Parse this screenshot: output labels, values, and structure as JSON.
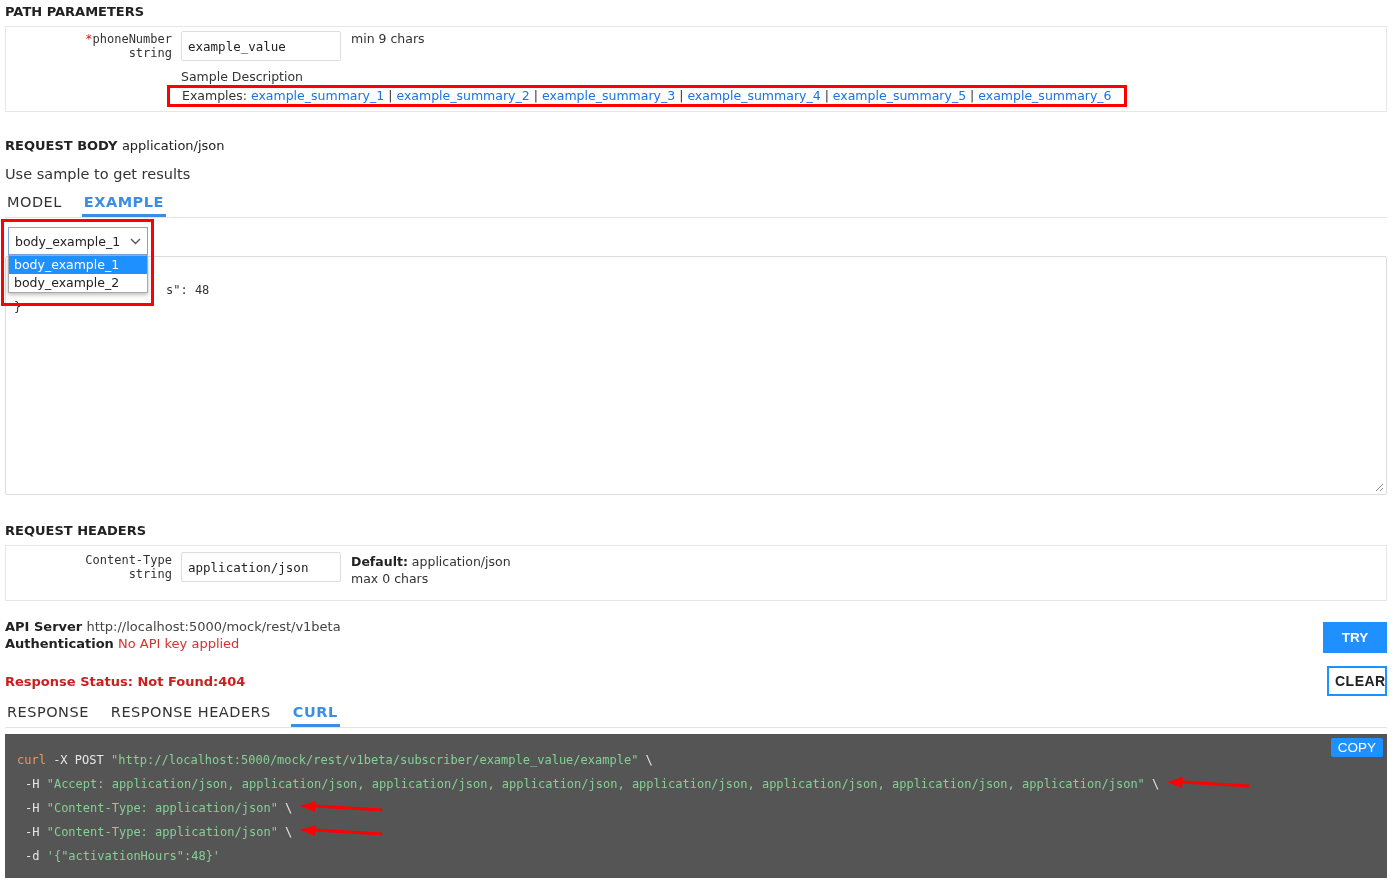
{
  "path_parameters": {
    "title": "PATH PARAMETERS",
    "params": [
      {
        "required_mark": "*",
        "name": "phoneNumber",
        "type": "string",
        "value": "example_value",
        "constraint": "min 9 chars",
        "description": "Sample Description",
        "examples_label": "Examples:",
        "highlighted": true,
        "examples": [
          {
            "label": "example_summary_1"
          },
          {
            "label": "example_summary_2"
          },
          {
            "label": "example_summary_3"
          },
          {
            "label": "example_summary_4"
          },
          {
            "label": "example_summary_5"
          },
          {
            "label": "example_summary_6"
          }
        ],
        "separators": [
          "|",
          "|",
          "|",
          "|",
          "|"
        ]
      }
    ]
  },
  "request_body": {
    "title": "REQUEST BODY",
    "content_type": "application/json",
    "description": "Use sample to get results",
    "tabs": [
      {
        "label": "MODEL",
        "selected": false
      },
      {
        "label": "EXAMPLE",
        "selected": true
      }
    ],
    "example_select": {
      "value": "body_example_1",
      "expanded": true,
      "highlighted": true,
      "options": [
        {
          "label": "body_example_1",
          "selected": true
        },
        {
          "label": "body_example_2",
          "selected": false
        }
      ]
    },
    "editor_lines": [
      "s\": 48",
      "}"
    ]
  },
  "request_headers": {
    "title": "REQUEST HEADERS",
    "params": [
      {
        "name": "Content-Type",
        "type": "string",
        "value": "application/json",
        "default_label": "Default:",
        "default_value": "application/json",
        "constraint": "max 0 chars"
      }
    ]
  },
  "server": {
    "api_server_label": "API Server",
    "api_server_url": "http://localhost:5000/mock/rest/v1beta",
    "auth_label": "Authentication",
    "auth_value": "No API key applied"
  },
  "buttons": {
    "try": "TRY",
    "clear": "CLEAR"
  },
  "response_status": "Response Status: Not Found:404",
  "response_tabs": [
    {
      "label": "RESPONSE",
      "selected": false
    },
    {
      "label": "RESPONSE HEADERS",
      "selected": false
    },
    {
      "label": "CURL",
      "selected": true
    }
  ],
  "curl": {
    "copy_label": "COPY",
    "lines": [
      {
        "arrow": false,
        "parts": [
          {
            "kind": "cmd",
            "text": "curl"
          },
          {
            "kind": "flag",
            "text": "-X POST"
          },
          {
            "kind": "string",
            "text": "\"http://localhost:5000/mock/rest/v1beta/subscriber/example_value/example\""
          },
          {
            "kind": "flag",
            "text": "\\"
          }
        ]
      },
      {
        "arrow": true,
        "parts": [
          {
            "kind": "flag",
            "text": "-H"
          },
          {
            "kind": "string",
            "text": "\"Accept: application/json, application/json, application/json, application/json, application/json, application/json, application/json, application/json\""
          },
          {
            "kind": "flag",
            "text": "\\"
          }
        ]
      },
      {
        "arrow": true,
        "parts": [
          {
            "kind": "flag",
            "text": "-H"
          },
          {
            "kind": "string",
            "text": "\"Content-Type: application/json\""
          },
          {
            "kind": "flag",
            "text": "\\"
          }
        ]
      },
      {
        "arrow": true,
        "parts": [
          {
            "kind": "flag",
            "text": "-H"
          },
          {
            "kind": "string",
            "text": "\"Content-Type: application/json\""
          },
          {
            "kind": "flag",
            "text": "\\"
          }
        ]
      },
      {
        "arrow": false,
        "parts": [
          {
            "kind": "flag",
            "text": "-d"
          },
          {
            "kind": "string",
            "text": "'{\"activationHours\":48}'"
          }
        ]
      }
    ]
  }
}
